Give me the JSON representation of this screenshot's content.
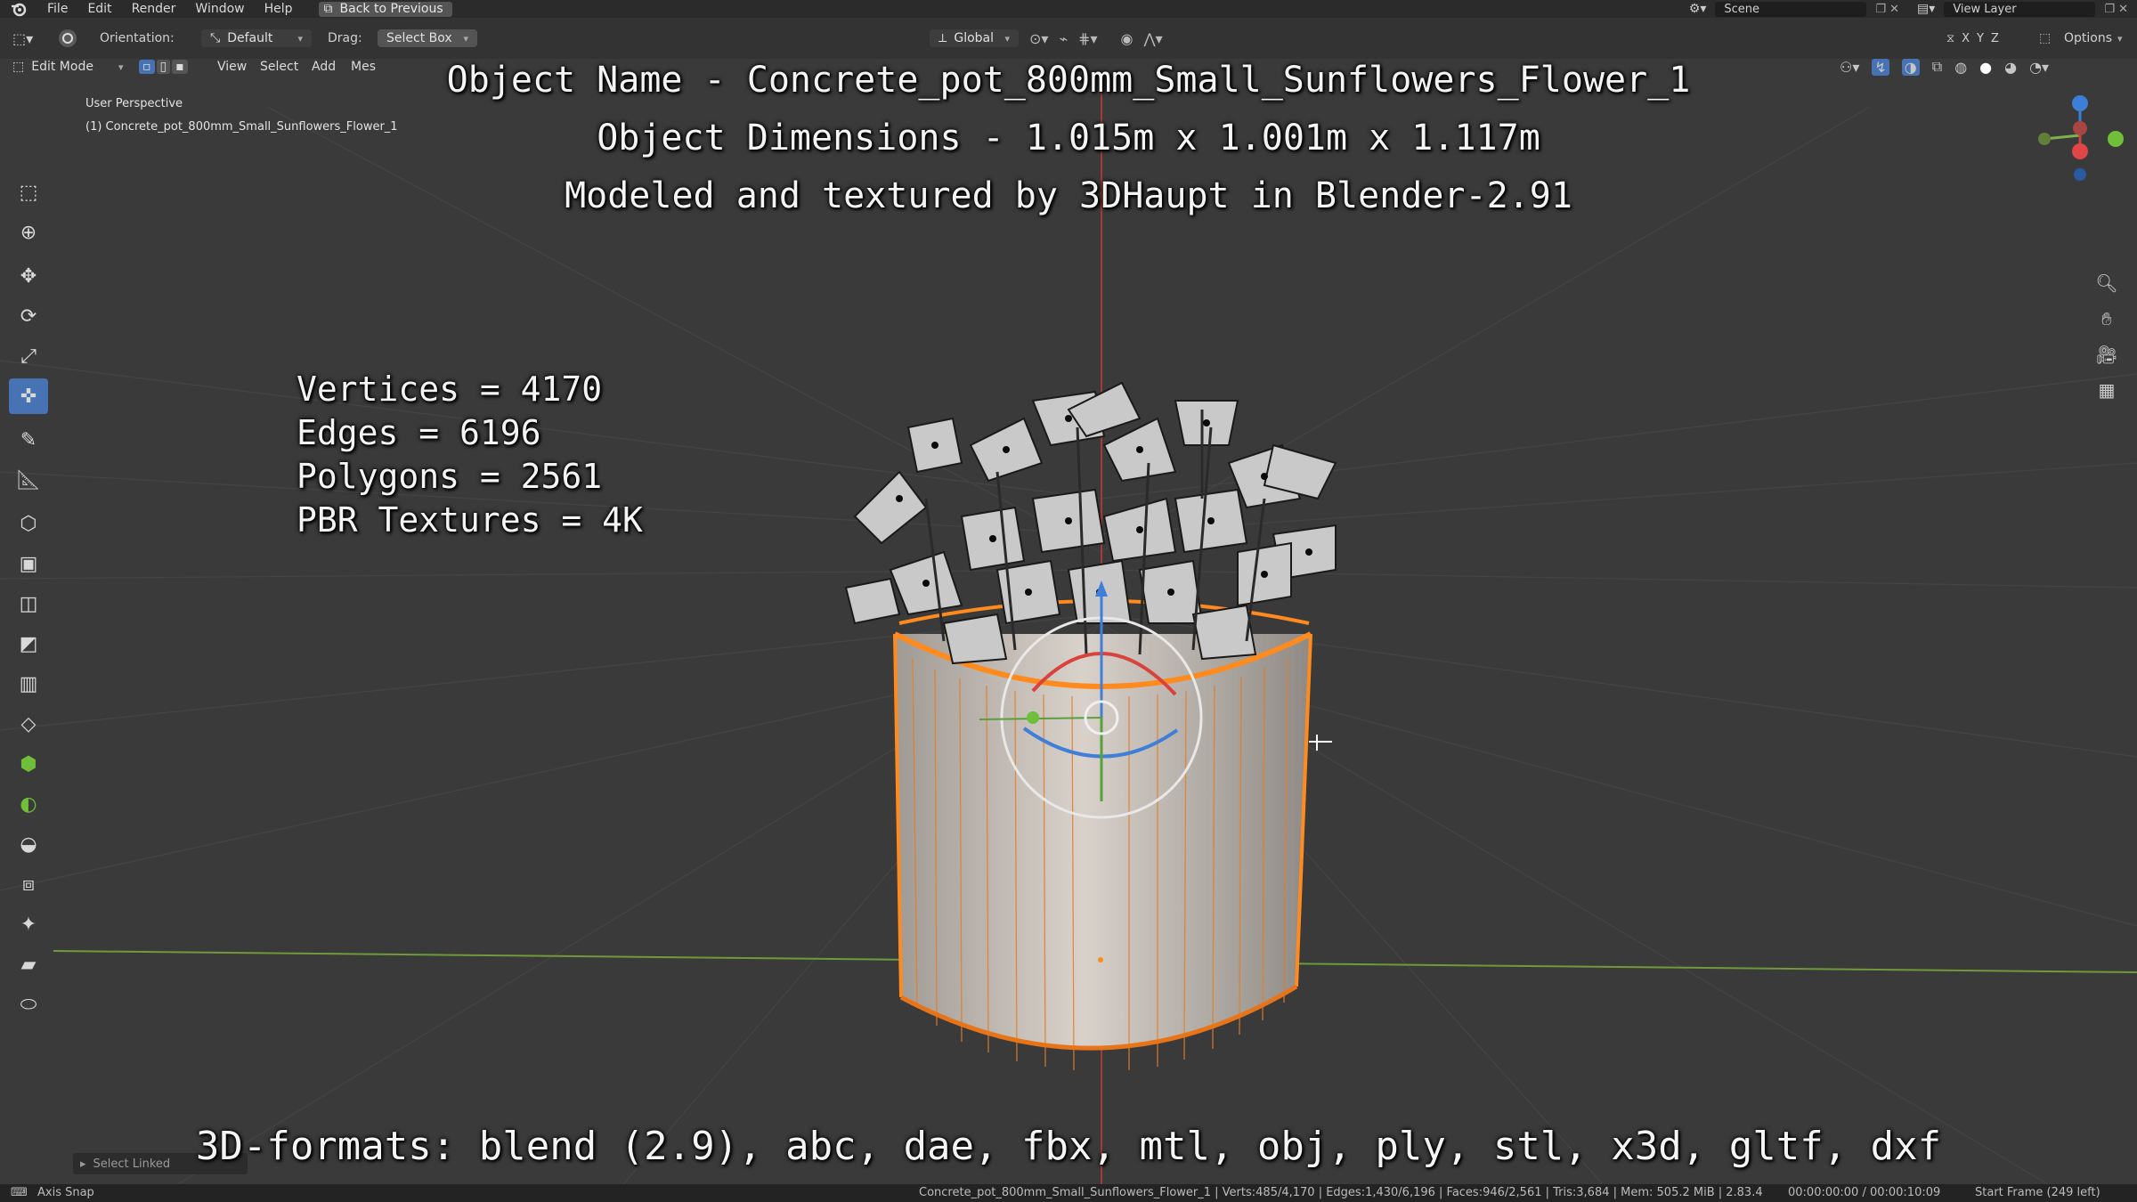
{
  "menu": {
    "items": [
      "File",
      "Edit",
      "Render",
      "Window",
      "Help"
    ],
    "back_button": "Back to Previous",
    "scene": "Scene",
    "view_layer": "View Layer"
  },
  "tool_settings": {
    "orientation_label": "Orientation:",
    "orientation_value": "Default",
    "drag_label": "Drag:",
    "drag_value": "Select Box",
    "transform_orientation": "Global",
    "axes": [
      "X",
      "Y",
      "Z"
    ],
    "options_label": "Options"
  },
  "header": {
    "mode": "Edit Mode",
    "menus": [
      "View",
      "Select",
      "Add",
      "Mes"
    ]
  },
  "viewport": {
    "perspective": "User Perspective",
    "object_label": "(1) Concrete_pot_800mm_Small_Sunflowers_Flower_1"
  },
  "overlay": {
    "name_line": "Object Name - Concrete_pot_800mm_Small_Sunflowers_Flower_1",
    "dimensions_line": "Object Dimensions -  1.015m x 1.001m x 1.117m",
    "credit_line": "Modeled and textured by 3DHaupt in Blender-2.91",
    "stats": [
      "Vertices = 4170",
      "Edges = 6196",
      "Polygons = 2561",
      "PBR Textures = 4K"
    ],
    "formats_line": "3D-formats: blend (2.9), abc, dae, fbx, mtl, obj, ply, stl, x3d, gltf, dxf"
  },
  "operator_panel": "Select Linked",
  "status": {
    "left": "Axis Snap",
    "stats": "Concrete_pot_800mm_Small_Sunflowers_Flower_1 | Verts:485/4,170 | Edges:1,430/6,196 | Faces:946/2,561 | Tris:3,684 | Mem: 505.2 MiB | 2.83.4",
    "time": "00:00:00:00 / 00:00:10:09",
    "frame": "Start Frame (249 left)"
  },
  "colors": {
    "viewport_bg": "#3a3a3a",
    "active_tool": "#4772b3",
    "selection": "#ff8a1e",
    "axis_x": "#c8453d",
    "axis_y": "#7fb04a",
    "axis_z": "#3d7fd6"
  }
}
